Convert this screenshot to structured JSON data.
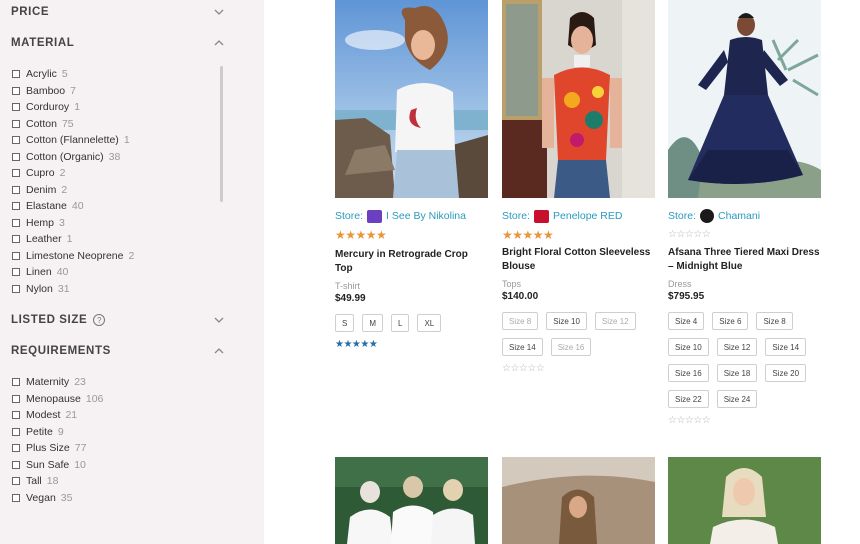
{
  "sidebar": {
    "price_title": "PRICE",
    "material_title": "MATERIAL",
    "materials": [
      {
        "label": "Acrylic",
        "count": "5"
      },
      {
        "label": "Bamboo",
        "count": "7"
      },
      {
        "label": "Corduroy",
        "count": "1"
      },
      {
        "label": "Cotton",
        "count": "75"
      },
      {
        "label": "Cotton (Flannelette)",
        "count": "1"
      },
      {
        "label": "Cotton (Organic)",
        "count": "38"
      },
      {
        "label": "Cupro",
        "count": "2"
      },
      {
        "label": "Denim",
        "count": "2"
      },
      {
        "label": "Elastane",
        "count": "40"
      },
      {
        "label": "Hemp",
        "count": "3"
      },
      {
        "label": "Leather",
        "count": "1"
      },
      {
        "label": "Limestone Neoprene",
        "count": "2"
      },
      {
        "label": "Linen",
        "count": "40"
      },
      {
        "label": "Nylon",
        "count": "31"
      }
    ],
    "listed_size_title": "LISTED SIZE",
    "help_glyph": "?",
    "requirements_title": "REQUIREMENTS",
    "requirements": [
      {
        "label": "Maternity",
        "count": "23"
      },
      {
        "label": "Menopause",
        "count": "106"
      },
      {
        "label": "Modest",
        "count": "21"
      },
      {
        "label": "Petite",
        "count": "9"
      },
      {
        "label": "Plus Size",
        "count": "77"
      },
      {
        "label": "Sun Safe",
        "count": "10"
      },
      {
        "label": "Tall",
        "count": "18"
      },
      {
        "label": "Vegan",
        "count": "35"
      }
    ]
  },
  "products": [
    {
      "store_prefix": "Store:",
      "store_name": "I See By Nikolina",
      "stars": "★★★★★",
      "name": "Mercury in Retrograde Crop Top",
      "category": "T-shirt",
      "price": "$49.99",
      "sizes": [
        "S",
        "M",
        "L",
        "XL"
      ],
      "bottom_stars": "★★★★★"
    },
    {
      "store_prefix": "Store:",
      "store_name": "Penelope RED",
      "stars": "★★★★★",
      "name": "Bright Floral Cotton Sleeveless Blouse",
      "category": "Tops",
      "price": "$140.00",
      "sizes": [
        "Size 8",
        "Size 10",
        "Size 12",
        "Size 14",
        "Size 16"
      ],
      "bottom_stars": "☆☆☆☆☆"
    },
    {
      "store_prefix": "Store:",
      "store_name": "Chamani",
      "stars": "☆☆☆☆☆",
      "name": "Afsana Three Tiered Maxi Dress – Midnight Blue",
      "category": "Dress",
      "price": "$795.95",
      "sizes": [
        "Size 4",
        "Size 6",
        "Size 8",
        "Size 10",
        "Size 12",
        "Size 14",
        "Size 16",
        "Size 18",
        "Size 20",
        "Size 22",
        "Size 24"
      ],
      "bottom_stars": "☆☆☆☆☆"
    }
  ],
  "colors": {
    "accent_link": "#2a9bc0",
    "star_gold": "#e8963a",
    "sidebar_bg": "#f6f1f2"
  }
}
